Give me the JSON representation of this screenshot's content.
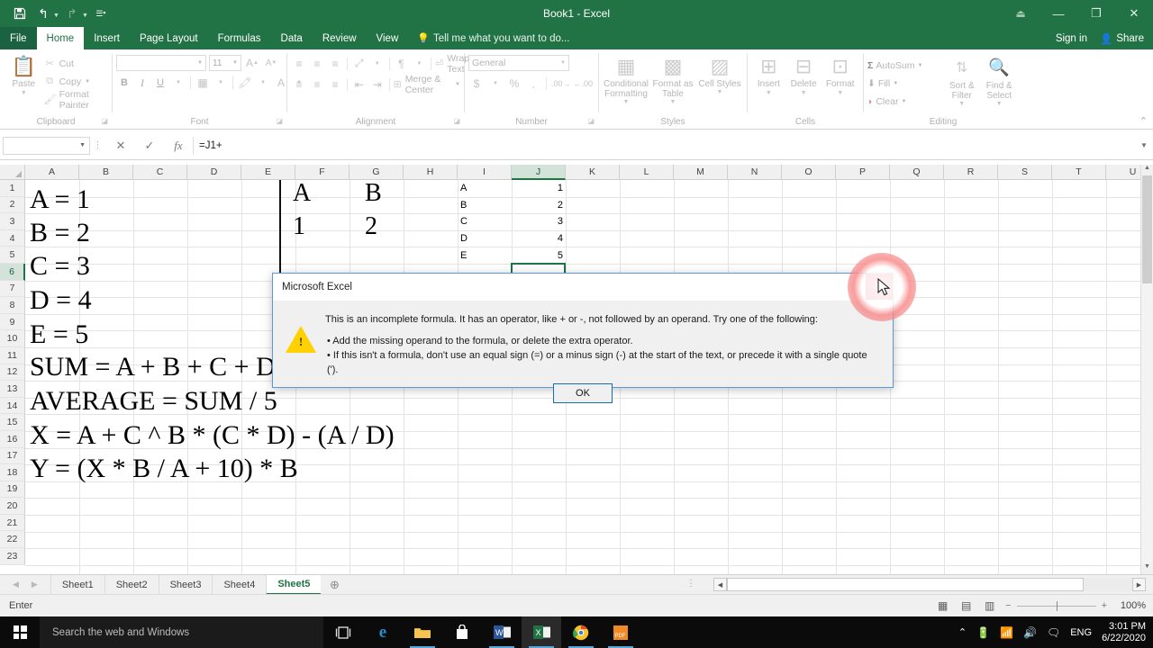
{
  "titlebar": {
    "document_title": "Book1 - Excel",
    "qat": [
      {
        "name": "save",
        "glyph": "💾"
      },
      {
        "name": "undo",
        "glyph": "↶"
      },
      {
        "name": "redo",
        "glyph": "↷"
      },
      {
        "name": "customize",
        "glyph": "☰"
      }
    ],
    "ribbon_display_options": "⬚",
    "minimize": "—",
    "restore": "❐",
    "close": "✕",
    "sign_in": "Sign in",
    "share": "Share"
  },
  "ribbon_tabs": [
    {
      "label": "File",
      "active": false
    },
    {
      "label": "Home",
      "active": true
    },
    {
      "label": "Insert",
      "active": false
    },
    {
      "label": "Page Layout",
      "active": false
    },
    {
      "label": "Formulas",
      "active": false
    },
    {
      "label": "Data",
      "active": false
    },
    {
      "label": "Review",
      "active": false
    },
    {
      "label": "View",
      "active": false
    }
  ],
  "tell_me": "Tell me what you want to do...",
  "ribbon": {
    "clipboard": {
      "group_label": "Clipboard",
      "paste": "Paste",
      "cut": "Cut",
      "copy": "Copy",
      "format_painter": "Format Painter"
    },
    "font": {
      "group_label": "Font",
      "font_name": "",
      "font_size": "11",
      "grow_font": "A",
      "shrink_font": "A",
      "bold": "B",
      "italic": "I",
      "underline": "U"
    },
    "alignment": {
      "group_label": "Alignment",
      "wrap_text": "Wrap Text",
      "merge_center": "Merge & Center"
    },
    "number": {
      "group_label": "Number",
      "format": "General",
      "accounting": "$",
      "percent": "%",
      "comma": ","
    },
    "styles": {
      "group_label": "Styles",
      "conditional_formatting": "Conditional Formatting",
      "format_as_table": "Format as Table",
      "cell_styles": "Cell Styles"
    },
    "cells": {
      "group_label": "Cells",
      "insert": "Insert",
      "delete": "Delete",
      "format": "Format"
    },
    "editing": {
      "group_label": "Editing",
      "autosum": "AutoSum",
      "fill": "Fill",
      "clear": "Clear",
      "sort_filter": "Sort & Filter",
      "find_select": "Find & Select"
    }
  },
  "formula_bar": {
    "name_box": "",
    "cancel": "✕",
    "enter": "✓",
    "insert_function": "fx",
    "formula": "=J1+"
  },
  "grid": {
    "columns": [
      "A",
      "B",
      "C",
      "D",
      "E",
      "F",
      "G",
      "H",
      "I",
      "J",
      "K",
      "L",
      "M",
      "N",
      "O",
      "P",
      "Q",
      "R",
      "S",
      "T",
      "U"
    ],
    "selected_column": "J",
    "rows": [
      1,
      2,
      3,
      4,
      5,
      6,
      7,
      8,
      9,
      10,
      11,
      12,
      13,
      14,
      15,
      16,
      17,
      18,
      19,
      20,
      21,
      22,
      23
    ],
    "selected_row": 6,
    "cells": [
      {
        "col": "I",
        "row": 1,
        "value": "A",
        "align": "left"
      },
      {
        "col": "I",
        "row": 2,
        "value": "B",
        "align": "left"
      },
      {
        "col": "I",
        "row": 3,
        "value": "C",
        "align": "left"
      },
      {
        "col": "I",
        "row": 4,
        "value": "D",
        "align": "left"
      },
      {
        "col": "I",
        "row": 5,
        "value": "E",
        "align": "left"
      },
      {
        "col": "J",
        "row": 1,
        "value": "1",
        "align": "right"
      },
      {
        "col": "J",
        "row": 2,
        "value": "2",
        "align": "right"
      },
      {
        "col": "J",
        "row": 3,
        "value": "3",
        "align": "right"
      },
      {
        "col": "J",
        "row": 4,
        "value": "4",
        "align": "right"
      },
      {
        "col": "J",
        "row": 5,
        "value": "5",
        "align": "right"
      }
    ]
  },
  "overlay": {
    "lines": [
      "A = 1",
      "B = 2",
      "C = 3",
      "D = 4",
      "E = 5",
      "SUM = A + B + C + D + E",
      "AVERAGE = SUM / 5",
      "X = A + C ^ B * (C * D) - (A / D)",
      "Y = (X * B / A + 10) * B"
    ],
    "table_header": [
      "A",
      "B"
    ],
    "table_values": [
      "1",
      "2"
    ]
  },
  "sheet_tabs": {
    "tabs": [
      {
        "label": "Sheet1",
        "active": false
      },
      {
        "label": "Sheet2",
        "active": false
      },
      {
        "label": "Sheet3",
        "active": false
      },
      {
        "label": "Sheet4",
        "active": false
      },
      {
        "label": "Sheet5",
        "active": true
      }
    ],
    "add_sheet": "+",
    "prev_arrow": "◀",
    "next_arrow": "▶"
  },
  "status_bar": {
    "mode": "Enter",
    "view_normal": "▦",
    "view_page_layout": "▤",
    "view_page_break": "▥",
    "zoom_out": "−",
    "zoom_in": "+",
    "zoom_level": "100%"
  },
  "dialog": {
    "title": "Microsoft Excel",
    "close": "✕",
    "warning_glyph": "!",
    "message_lead": "This is an incomplete formula. It has an operator, like + or -, not followed by an operand. Try one of the following:",
    "bullets": [
      "• Add the missing operand to the formula, or delete the extra operator.",
      "• If this isn't a formula, don't use an equal sign (=) or a minus sign (-) at the start of the text, or precede it with a single quote (')."
    ],
    "ok_label": "OK"
  },
  "taskbar": {
    "search_placeholder": "Search the web and Windows",
    "apps": [
      {
        "name": "task-view",
        "glyph": "⌷"
      },
      {
        "name": "edge",
        "glyph": "e"
      },
      {
        "name": "file-explorer",
        "glyph": "🗁"
      },
      {
        "name": "store",
        "glyph": "🛍"
      },
      {
        "name": "word",
        "glyph": "W"
      },
      {
        "name": "excel",
        "glyph": "X"
      },
      {
        "name": "chrome",
        "glyph": "◯"
      },
      {
        "name": "pdf-reader",
        "glyph": "PDF"
      }
    ],
    "tray": {
      "show_hidden": "⌃",
      "battery": "🔋",
      "wifi": "◡",
      "volume": "🔊",
      "action_center": "💬",
      "language": "ENG",
      "time": "3:01 PM",
      "date": "6/22/2020"
    }
  },
  "colors": {
    "excel_green": "#217346",
    "close_red": "#e81123",
    "dialog_border": "#5b9bd5",
    "warning_yellow": "#ffd100"
  }
}
